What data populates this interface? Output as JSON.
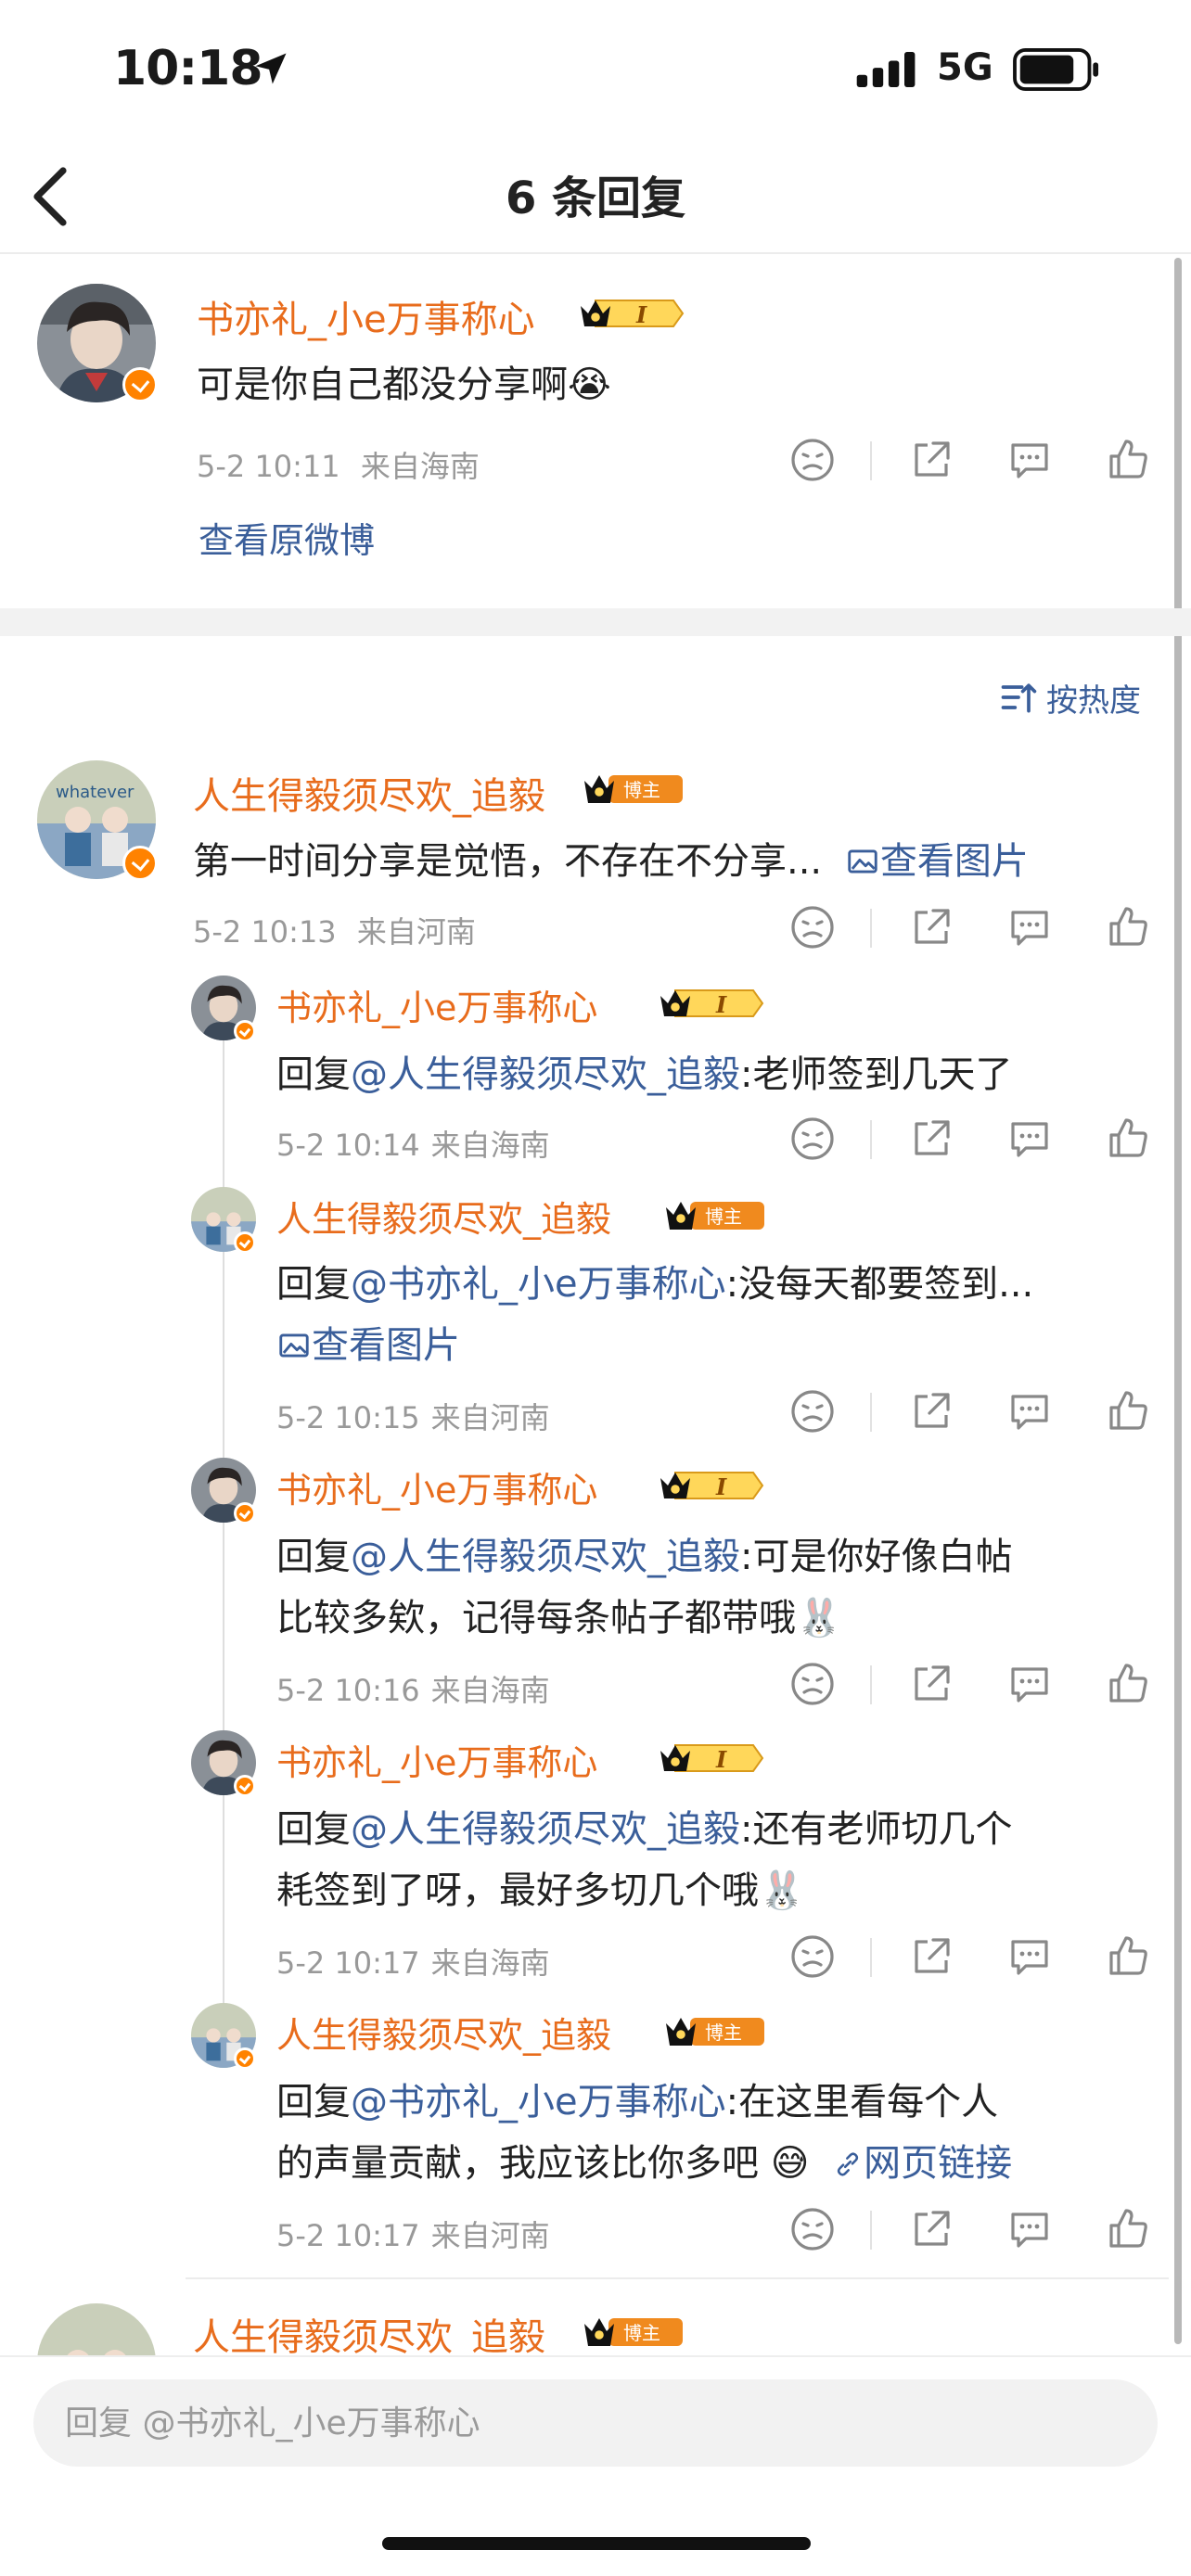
{
  "status_bar": {
    "time": "10:18",
    "network": "5G"
  },
  "nav": {
    "title": "6 条回复"
  },
  "root_comment": {
    "username": "书亦礼_小e万事称心",
    "text": "可是你自己都没分享啊😭",
    "date": "5-2 10:11",
    "location": "来自海南",
    "view_original": "查看原微博"
  },
  "sort": {
    "label": "按热度"
  },
  "comments": [
    {
      "username": "人生得毅须尽欢_追毅",
      "badge": "博主",
      "text": "第一时间分享是觉悟，不存在不分享...",
      "link": "查看图片",
      "date": "5-2 10:13",
      "location": "来自河南"
    }
  ],
  "replies": [
    {
      "username": "书亦礼_小e万事称心",
      "reply_prefix": "回复",
      "mention": "@人生得毅须尽欢_追毅",
      "line1": ":老师签到几天了",
      "line2": "",
      "link": "",
      "date": "5-2 10:14",
      "location": "来自海南"
    },
    {
      "username": "人生得毅须尽欢_追毅",
      "badge": "博主",
      "reply_prefix": "回复",
      "mention": "@书亦礼_小e万事称心",
      "line1": ":没每天都要签到...",
      "line2": "",
      "link": "查看图片",
      "date": "5-2 10:15",
      "location": "来自河南"
    },
    {
      "username": "书亦礼_小e万事称心",
      "reply_prefix": "回复",
      "mention": "@人生得毅须尽欢_追毅",
      "line1": ":可是你好像白帖",
      "line2": "比较多欸，记得每条帖子都带哦🐰",
      "link": "",
      "date": "5-2 10:16",
      "location": "来自海南"
    },
    {
      "username": "书亦礼_小e万事称心",
      "reply_prefix": "回复",
      "mention": "@人生得毅须尽欢_追毅",
      "line1": ":还有老师切几个",
      "line2": "耗签到了呀，最好多切几个哦🐰",
      "link": "",
      "date": "5-2 10:17",
      "location": "来自海南"
    },
    {
      "username": "人生得毅须尽欢_追毅",
      "badge": "博主",
      "reply_prefix": "回复",
      "mention": "@书亦礼_小e万事称心",
      "line1": ":在这里看每个人",
      "line2": "的声量贡献，我应该比你多吧 😅",
      "link": "网页链接",
      "date": "5-2 10:17",
      "location": "来自河南"
    }
  ],
  "next_comment": {
    "username": "人生得毅须尽欢_追毅",
    "badge": "博主"
  },
  "reply_bar": {
    "placeholder": "回复 @书亦礼_小e万事称心"
  },
  "colors": {
    "username": "#e86c1c",
    "link": "#3a5e9a",
    "meta": "#999999",
    "badge": "#ff8200"
  }
}
